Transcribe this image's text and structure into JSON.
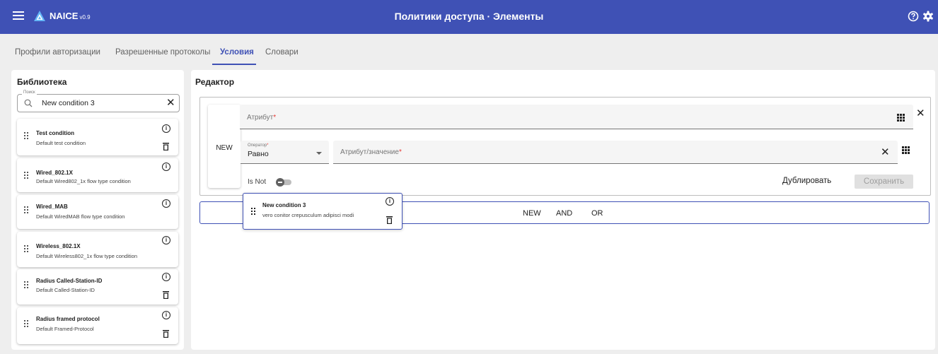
{
  "appbar": {
    "brand": "NAICE",
    "version": "v0.9",
    "title": "Политики доступа · Элементы",
    "color": "#3f51b5"
  },
  "tabs": [
    {
      "label": "Профили авторизации",
      "active": false
    },
    {
      "label": "Разрешенные протоколы",
      "active": false
    },
    {
      "label": "Условия",
      "active": true
    },
    {
      "label": "Словари",
      "active": false
    }
  ],
  "library": {
    "title": "Библиотека",
    "search": {
      "legend": "Поиск",
      "value": "New condition 3"
    },
    "items": [
      {
        "name": "Test condition",
        "description": "Default test condition",
        "deletable": true
      },
      {
        "name": "Wired_802.1X",
        "description": "Default Wired802_1x flow type condition",
        "deletable": false
      },
      {
        "name": "Wired_MAB",
        "description": "Default WiredMAB flow type condition",
        "deletable": false
      },
      {
        "name": "Wireless_802.1X",
        "description": "Default Wireless802_1x flow type condition",
        "deletable": false
      },
      {
        "name": "Radius Called-Station-ID",
        "description": "Default Called-Station-ID",
        "deletable": true
      },
      {
        "name": "Radius framed protocol",
        "description": "Default Framed-Protocol",
        "deletable": true
      }
    ]
  },
  "editor": {
    "title": "Редактор",
    "new_label": "NEW",
    "attribute_placeholder": "Атрибут",
    "operator_label": "Оператор",
    "operator_value": "Равно",
    "value_placeholder": "Атрибут/значение",
    "is_not_label": "Is Not",
    "duplicate_label": "Дублировать",
    "save_label": "Сохранить",
    "ops": [
      "NEW",
      "AND",
      "OR"
    ]
  },
  "dragging_item": {
    "name": "New condition 3",
    "description": "vero conitor crepusculum adipisci modi"
  }
}
